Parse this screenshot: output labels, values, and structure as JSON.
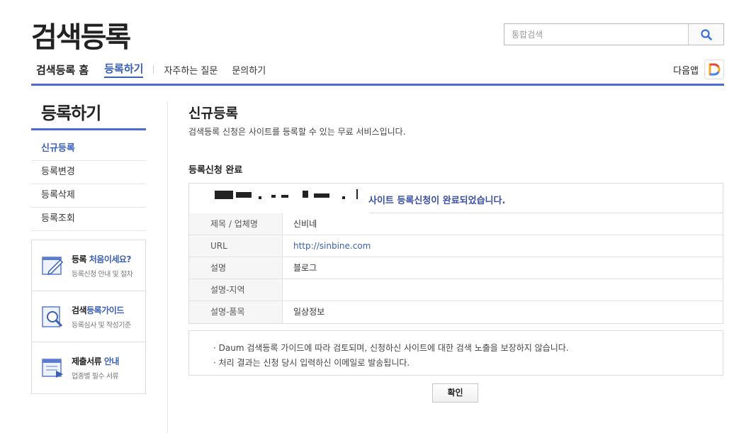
{
  "header": {
    "site_title": "검색등록",
    "search_placeholder": "통합검색",
    "nav": {
      "home": "검색등록 홈",
      "register": "등록하기",
      "faq": "자주하는 질문",
      "inquiry": "문의하기"
    },
    "daum_app": "다음앱"
  },
  "sidebar": {
    "title": "등록하기",
    "items": [
      {
        "label": "신규등록"
      },
      {
        "label": "등록변경"
      },
      {
        "label": "등록삭제"
      },
      {
        "label": "등록조회"
      }
    ],
    "banners": [
      {
        "title_plain": "등록 ",
        "title_accent": "처음이세요?",
        "subtitle": "등록신청 안내 및 절차"
      },
      {
        "title_plain": "검색",
        "title_accent": "등록가이드",
        "subtitle": "등록심사 및 작성기준"
      },
      {
        "title_plain": "제출서류 ",
        "title_accent": "안내",
        "subtitle": "업종별 필수 서류"
      }
    ]
  },
  "content": {
    "title": "신규등록",
    "description": "검색등록 신청은 사이트를 등록할 수 있는 무료 서비스입니다.",
    "section_title": "등록신청 완료",
    "result_message": "사이트 등록신청이 완료되었습니다.",
    "rows": [
      {
        "label": "제목 / 업체명",
        "value": "신비네"
      },
      {
        "label": "URL",
        "value": "http://sinbine.com"
      },
      {
        "label": "설명",
        "value": "블로그"
      },
      {
        "label": "설명-지역",
        "value": ""
      },
      {
        "label": "설명-품목",
        "value": "일상정보"
      }
    ],
    "notices": [
      "· Daum 검색등록 가이드에 따라 검토되며, 신청하신 사이트에 대한 검색 노출을 보장하지 않습니다.",
      "· 처리 결과는 신청 당시 입력하신 이메일로 발송됩니다."
    ],
    "confirm_button": "확인"
  },
  "colors": {
    "accent": "#4c6ad0",
    "link": "#3a5fb6"
  }
}
